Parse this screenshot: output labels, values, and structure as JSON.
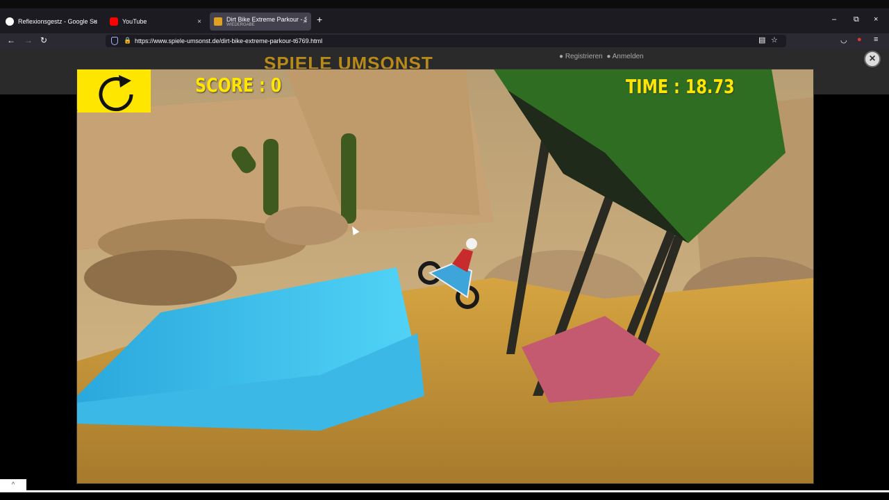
{
  "browser": {
    "tabs": [
      {
        "title": "Reflexionsgestz - Google Suche",
        "close": "×"
      },
      {
        "title": "YouTube",
        "close": "×"
      },
      {
        "title": "Dirt Bike Extreme Parkour - Spie",
        "subtitle": "WIEDERGABE",
        "close": "×"
      }
    ],
    "new_tab": "+",
    "url": "https://www.spiele-umsonst.de/dirt-bike-extreme-parkour-t6769.html",
    "window_controls": {
      "minimize": "–",
      "maximize": "⧉",
      "close": "×"
    }
  },
  "site": {
    "logo": "SPIELE UMSONST",
    "register": "Registrieren",
    "login": "Anmelden",
    "close_overlay": "×",
    "scroll_top": "^"
  },
  "game": {
    "score_label": "SCORE : 0",
    "time_label": "TIME : 18.73",
    "colors": {
      "hud": "#ffe600",
      "sand": "#c9a24a",
      "blue_container": "#3cc3f0",
      "green_container": "#3c8a2a",
      "red_container": "#c0566a"
    }
  }
}
